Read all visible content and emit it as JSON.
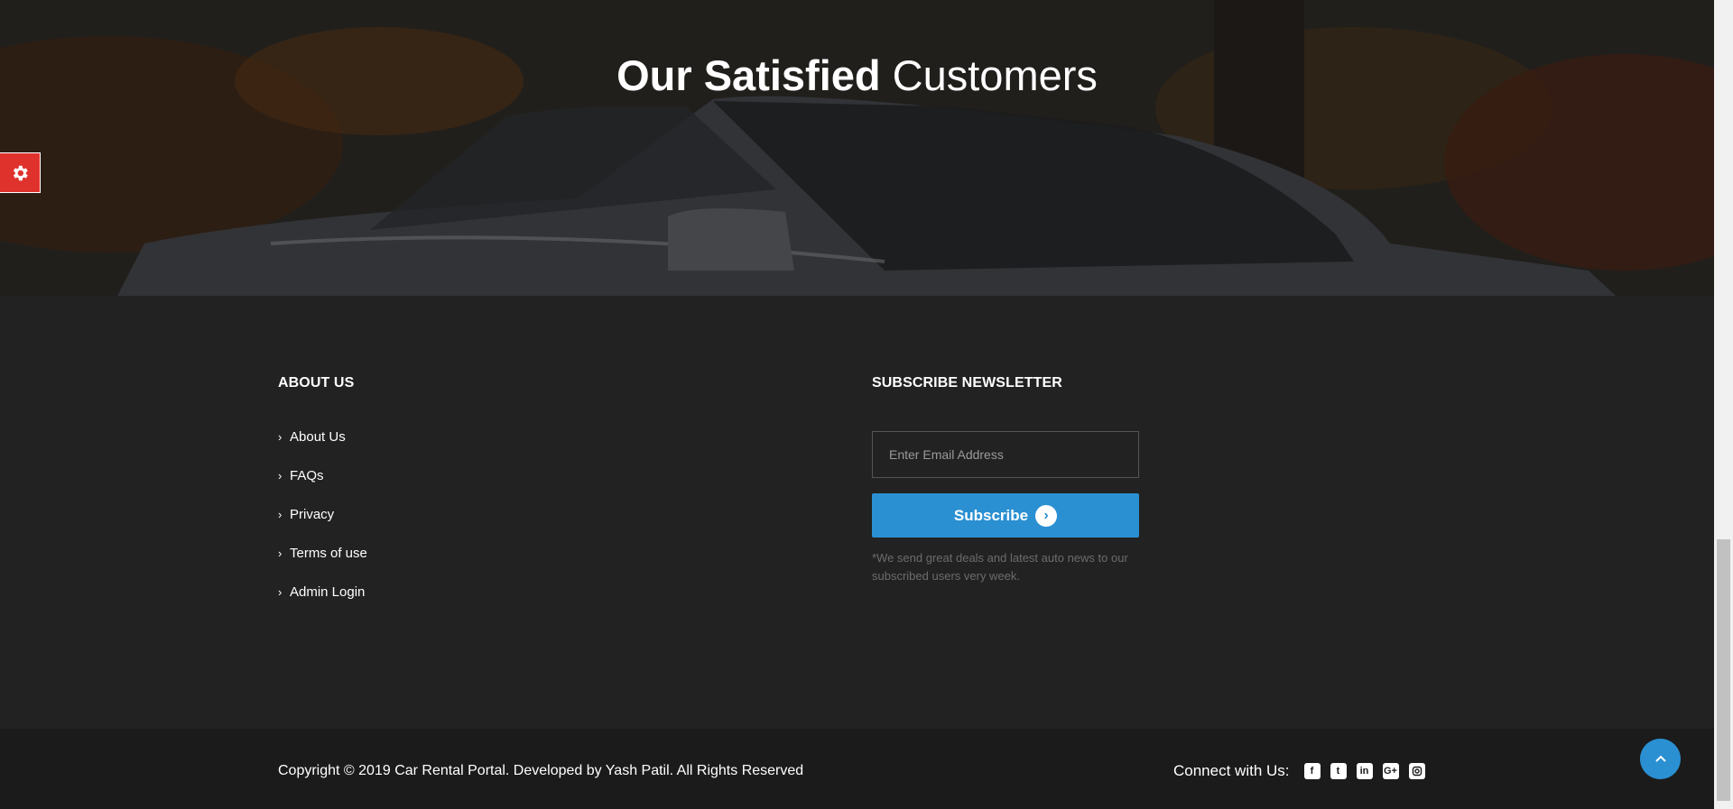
{
  "hero": {
    "title_bold": "Our Satisfied",
    "title_light": "Customers"
  },
  "settings": {
    "icon": "gear-icon",
    "color": "#e0322d"
  },
  "about": {
    "heading": "ABOUT US",
    "links": [
      {
        "label": "About Us"
      },
      {
        "label": "FAQs"
      },
      {
        "label": "Privacy"
      },
      {
        "label": "Terms of use"
      },
      {
        "label": "Admin Login"
      }
    ]
  },
  "newsletter": {
    "heading": "SUBSCRIBE NEWSLETTER",
    "email_placeholder": "Enter Email Address",
    "email_value": "",
    "button_label": "Subscribe",
    "note": "*We send great deals and latest auto news to our subscribed users very week."
  },
  "bottom": {
    "copyright": "Copyright © 2019 Car Rental Portal. Developed by Yash Patil. All Rights Reserved",
    "connect_label": "Connect with Us:",
    "social": [
      "facebook-icon",
      "twitter-icon",
      "linkedin-icon",
      "google-plus-icon",
      "instagram-icon"
    ]
  },
  "colors": {
    "accent": "#2a90d2",
    "footer_bg": "#222222",
    "footer_bottom_bg": "#1b1b1b"
  }
}
